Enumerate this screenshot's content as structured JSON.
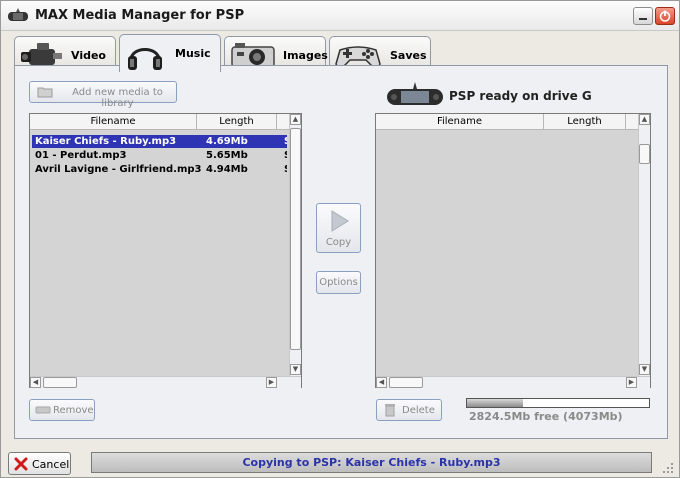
{
  "window": {
    "title": "MAX Media Manager for PSP"
  },
  "tabs": [
    {
      "label": "Video",
      "icon": "camcorder-icon",
      "active": false
    },
    {
      "label": "Music",
      "icon": "headphones-icon",
      "active": true
    },
    {
      "label": "Images",
      "icon": "camera-icon",
      "active": false
    },
    {
      "label": "Saves",
      "icon": "gamepad-icon",
      "active": false
    }
  ],
  "library": {
    "add_button_label": "Add new media to library",
    "columns": [
      "Filename",
      "Length"
    ],
    "rows": [
      {
        "filename": "Kaiser Chiefs - Ruby.mp3",
        "length": "4.69Mb",
        "extra": "S",
        "selected": true
      },
      {
        "filename": "01 - Perdut.mp3",
        "length": "5.65Mb",
        "extra": "S",
        "selected": false
      },
      {
        "filename": "Avril Lavigne - Girlfriend.mp3",
        "length": "4.94Mb",
        "extra": "S",
        "selected": false
      }
    ],
    "remove_label": "Remove"
  },
  "middle": {
    "copy_label": "Copy",
    "options_label": "Options"
  },
  "psp": {
    "status": "PSP ready on drive G",
    "columns": [
      "Filename",
      "Length"
    ],
    "delete_label": "Delete",
    "free_space": "2824.5Mb free (4073Mb)",
    "usage_fraction": 0.31
  },
  "bottom": {
    "cancel_label": "Cancel",
    "status_text": "Copying to PSP: Kaiser Chiefs - Ruby.mp3"
  },
  "colors": {
    "selection": "#2f34b5",
    "status_text": "#2a32a8",
    "close_button": "#d7462a"
  }
}
